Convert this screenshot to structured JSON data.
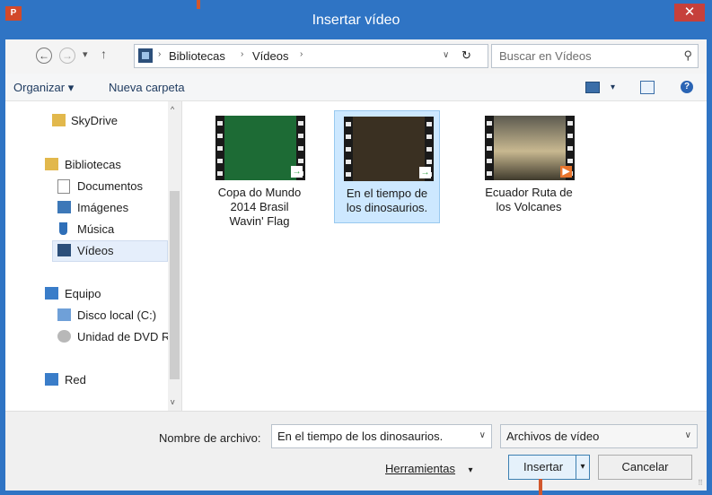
{
  "window": {
    "title": "Insertar vídeo",
    "app_icon": "P ",
    "close_glyph": "✕",
    "app_icon_text": "P"
  },
  "navbar": {
    "back_glyph": "←",
    "forward_glyph": "→",
    "recent_glyph": "▾",
    "up_glyph": "↑",
    "breadcrumb": [
      "Bibliotecas",
      "Vídeos"
    ],
    "separator": "›",
    "dropdown_glyph": "∨",
    "refresh_glyph": "↻",
    "search_placeholder": "Buscar en Vídeos",
    "search_glyph": "⚲"
  },
  "cmdbar": {
    "organize": "Organizar ▾",
    "new_folder": "Nueva carpeta",
    "view_glyph": "▾",
    "help_glyph": "?"
  },
  "sidebar": {
    "items": [
      {
        "label": "SkyDrive"
      },
      {
        "label": "Bibliotecas"
      },
      {
        "label": "Documentos"
      },
      {
        "label": "Imágenes"
      },
      {
        "label": "Música"
      },
      {
        "label": "Vídeos"
      },
      {
        "label": "Equipo"
      },
      {
        "label": "Disco local (C:)"
      },
      {
        "label": "Unidad de DVD R"
      },
      {
        "label": "Red"
      }
    ],
    "scroll_up": "^",
    "scroll_down": "v"
  },
  "files": [
    {
      "name": "Copa do Mundo 2014 Brasil Wavin' Flag",
      "line1": "Copa do Mundo",
      "line2": "2014 Brasil",
      "line3": "Wavin' Flag",
      "badge": "→"
    },
    {
      "name": "En el tiempo de los dinosaurios.",
      "line1": "En el tiempo de",
      "line2": "los dinosaurios.",
      "line3": "",
      "badge": "→"
    },
    {
      "name": "Ecuador Ruta de los Volcanes",
      "line1": "Ecuador Ruta de",
      "line2": "los Volcanes",
      "line3": "",
      "badge": "▶"
    }
  ],
  "bottom": {
    "filename_label": "Nombre de archivo:",
    "filename_value": "En el tiempo de los dinosaurios.",
    "filetype_value": "Archivos de vídeo",
    "tools_label": "Herramientas",
    "tools_glyph": "▾",
    "insert_label": "Insertar",
    "insert_split_glyph": "▾",
    "cancel_label": "Cancelar",
    "dropdown_glyph": "∨"
  },
  "colors": {
    "title_bar": "#2f74c4",
    "close": "#c6403b",
    "selection": "#cde8ff",
    "marker": "#d2572c"
  }
}
